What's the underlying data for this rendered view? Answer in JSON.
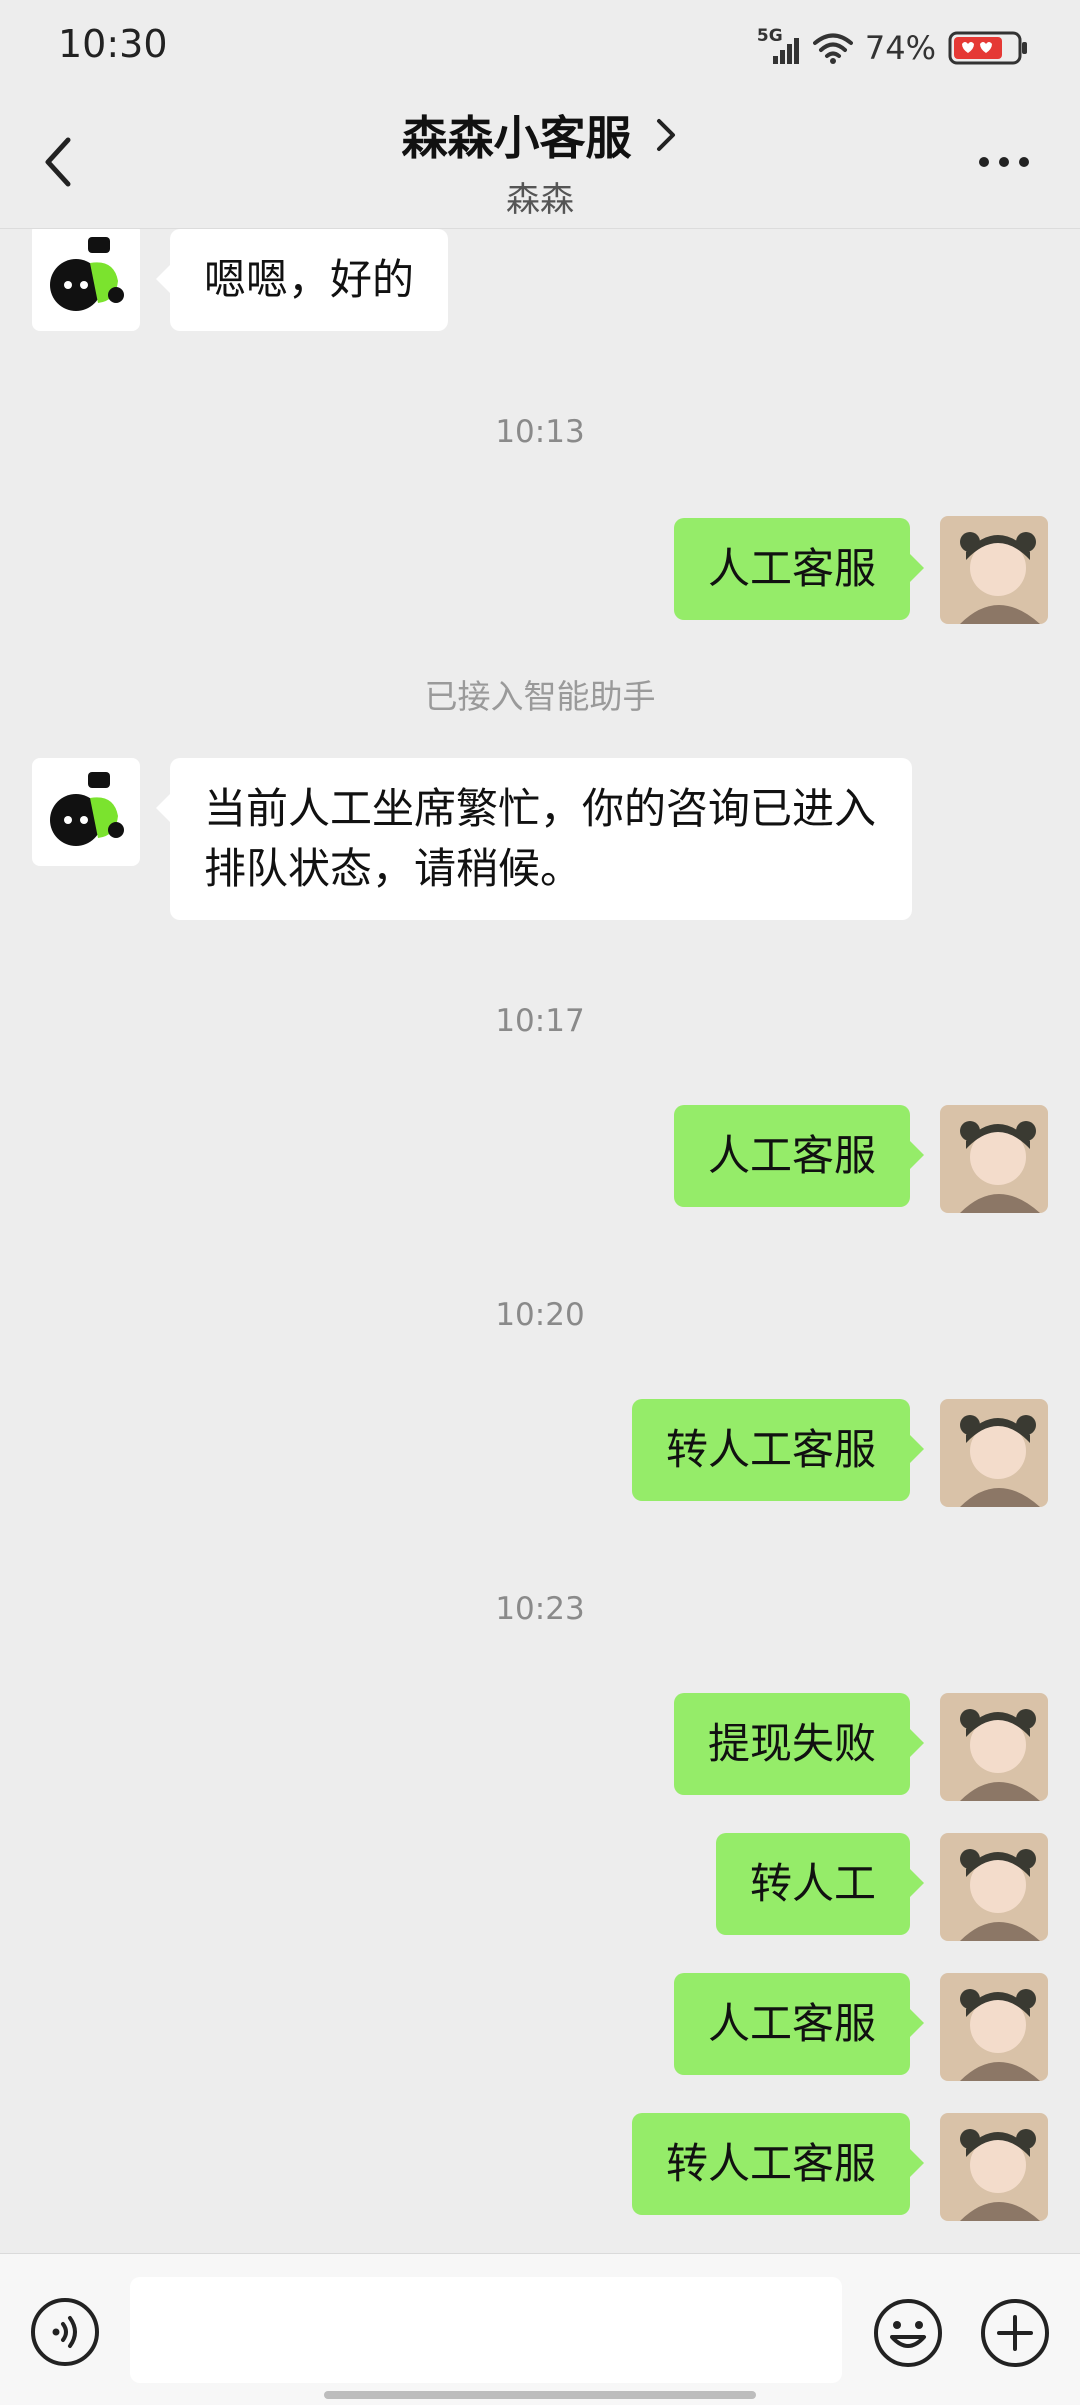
{
  "status_bar": {
    "time": "10:30",
    "network": "5G",
    "battery": "74%"
  },
  "header": {
    "title": "森森小客服",
    "subtitle": "森森"
  },
  "messages": [
    {
      "text": "嗯嗯，好的"
    },
    {
      "time": "10:13"
    },
    {
      "text": "人工客服"
    },
    {
      "system": "已接入智能助手"
    },
    {
      "text": "当前人工坐席繁忙，你的咨询已进入排队状态，请稍候。"
    },
    {
      "time": "10:17"
    },
    {
      "text": "人工客服"
    },
    {
      "time": "10:20"
    },
    {
      "text": "转人工客服"
    },
    {
      "time": "10:23"
    },
    {
      "text": "提现失败"
    },
    {
      "text": "转人工"
    },
    {
      "text": "人工客服"
    },
    {
      "text": "转人工客服"
    }
  ],
  "input": {
    "value": ""
  },
  "colors": {
    "outgoing_bubble": "#95EC69",
    "incoming_bubble": "#FFFFFF",
    "background": "#EDEDED"
  }
}
